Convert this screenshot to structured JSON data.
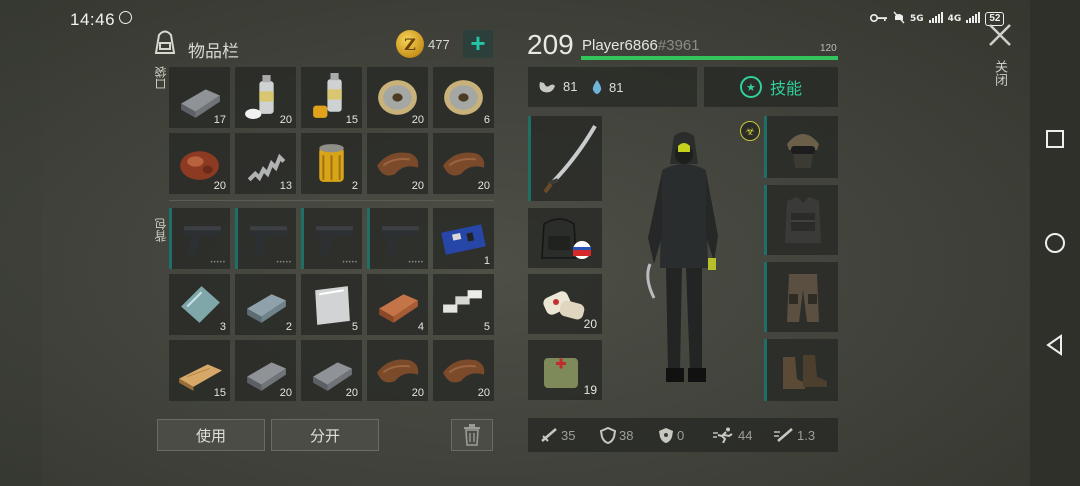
{
  "status_bar": {
    "time": "14:46",
    "signal_1": "5G",
    "signal_2": "4G",
    "battery": "52"
  },
  "inventory": {
    "title": "物品栏",
    "coins": "477",
    "pockets_label": "口袋",
    "backpack_label": "背包",
    "pockets": [
      {
        "icon": "metal-bar-icon",
        "count": "17"
      },
      {
        "icon": "spray-can-white-icon",
        "count": "20"
      },
      {
        "icon": "spray-can-yellow-icon",
        "count": "15"
      },
      {
        "icon": "wire-spool-icon",
        "count": "20"
      },
      {
        "icon": "wire-spool-icon",
        "count": "6"
      },
      {
        "icon": "raw-meat-icon",
        "count": "20"
      },
      {
        "icon": "spring-icon",
        "count": "13"
      },
      {
        "icon": "oil-filter-icon",
        "count": "2"
      },
      {
        "icon": "leather-icon",
        "count": "20"
      },
      {
        "icon": "leather-icon",
        "count": "20"
      }
    ],
    "backpack": [
      {
        "icon": "pistol-icon",
        "count": "",
        "marked": true
      },
      {
        "icon": "pistol-icon",
        "count": "",
        "marked": true
      },
      {
        "icon": "pistol-icon",
        "count": "",
        "marked": true
      },
      {
        "icon": "pistol-icon",
        "count": "",
        "marked": true
      },
      {
        "icon": "circuit-board-icon",
        "count": "1",
        "marked": false
      },
      {
        "icon": "glass-sheet-icon",
        "count": "3",
        "marked": false
      },
      {
        "icon": "steel-ingot-icon",
        "count": "2",
        "marked": false
      },
      {
        "icon": "aluminum-sheet-icon",
        "count": "5",
        "marked": false
      },
      {
        "icon": "copper-ingot-icon",
        "count": "4",
        "marked": false
      },
      {
        "icon": "bolts-icon",
        "count": "5",
        "marked": false
      },
      {
        "icon": "wood-plank-icon",
        "count": "15",
        "marked": false
      },
      {
        "icon": "metal-bar-icon",
        "count": "20",
        "marked": false
      },
      {
        "icon": "metal-bar-icon",
        "count": "20",
        "marked": false
      },
      {
        "icon": "leather-icon",
        "count": "20",
        "marked": false
      },
      {
        "icon": "leather-icon",
        "count": "20",
        "marked": false
      }
    ],
    "use_label": "使用",
    "split_label": "分开"
  },
  "player": {
    "level": "209",
    "name": "Player6866",
    "tag": "#3961",
    "xp_max": "120",
    "xp_fraction": 1.0,
    "hunger": "81",
    "thirst": "81",
    "skills_label": "技能"
  },
  "equipment": {
    "weapon": {
      "icon": "katana-icon",
      "count": ""
    },
    "backpack": {
      "icon": "tactical-backpack-icon",
      "count": ""
    },
    "medkit": {
      "icon": "bandage-icon",
      "count": "20"
    },
    "food": {
      "icon": "first-aid-pouch-icon",
      "count": "19"
    },
    "helmet": {
      "icon": "helmet-icon"
    },
    "vest": {
      "icon": "armor-vest-icon"
    },
    "pants": {
      "icon": "armored-pants-icon"
    },
    "boots": {
      "icon": "boots-icon"
    }
  },
  "stats": {
    "attack": "35",
    "defense": "38",
    "radiation": "0",
    "speed": "44",
    "attack_speed": "1.3"
  },
  "close_label": "关闭",
  "colors": {
    "accent": "#2fd19c",
    "xp": "#33c45b",
    "slot_marker": "#1e6f65"
  }
}
